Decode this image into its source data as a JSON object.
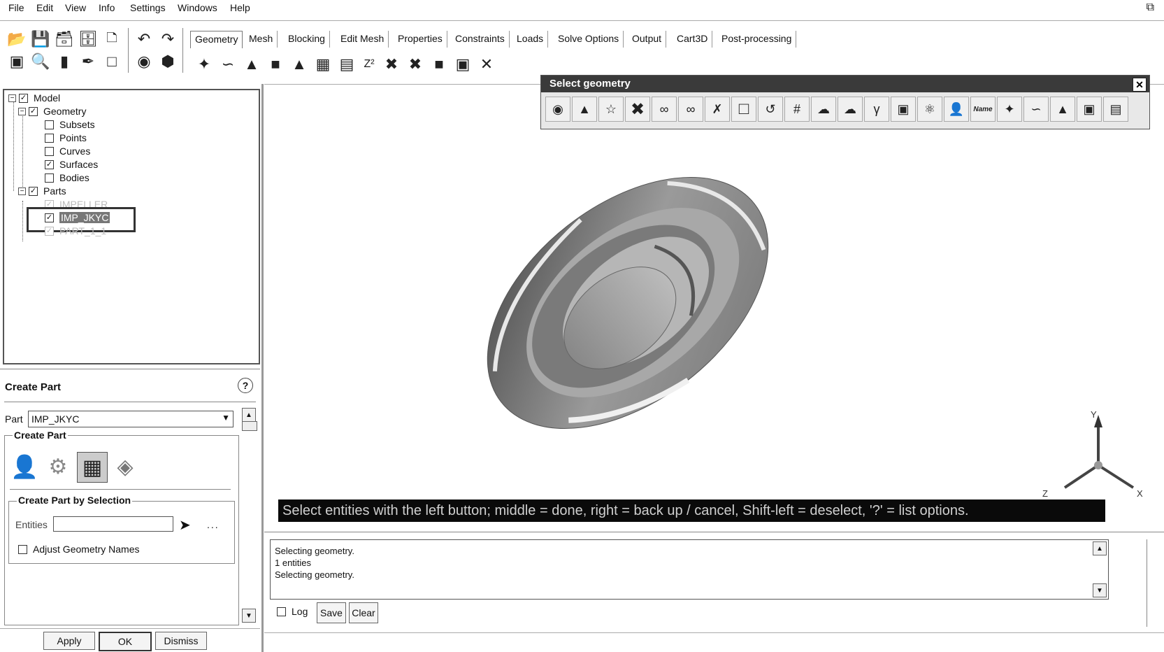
{
  "menu": [
    "File",
    "Edit",
    "View",
    "Info",
    "Settings",
    "Windows",
    "Help"
  ],
  "tabs": [
    "Geometry",
    "Mesh",
    "Blocking",
    "Edit Mesh",
    "Properties",
    "Constraints",
    "Loads",
    "Solve Options",
    "Output",
    "Cart3D",
    "Post-processing"
  ],
  "tree": {
    "model": "Model",
    "geometry": "Geometry",
    "subsets": "Subsets",
    "points": "Points",
    "curves": "Curves",
    "surfaces": "Surfaces",
    "bodies": "Bodies",
    "parts": "Parts",
    "part1": "IMPELLER",
    "part2": "IMP_JKYC",
    "part3": "PART_1_1"
  },
  "panel": {
    "title": "Create Part",
    "part_label": "Part",
    "part_value": "IMP_JKYC",
    "section_title": "Create Part",
    "subsection_title": "Create Part by Selection",
    "entities_label": "Entities",
    "entities_value": "",
    "entities_more": "...",
    "adjust_names_label": "Adjust Geometry Names",
    "apply": "Apply",
    "ok": "OK",
    "dismiss": "Dismiss"
  },
  "select_geometry": {
    "title": "Select geometry"
  },
  "status_banner": "Select entities with the left button; middle = done, right = back up / cancel, Shift-left = deselect, '?' = list options.",
  "messages": [
    "Selecting geometry.",
    "1 entities",
    "Selecting geometry."
  ],
  "message_controls": {
    "log": "Log",
    "save": "Save",
    "clear": "Clear"
  },
  "axes": {
    "x": "X",
    "y": "Y",
    "z": "Z"
  },
  "sel_name_icon": "Name",
  "help_icon": "?"
}
